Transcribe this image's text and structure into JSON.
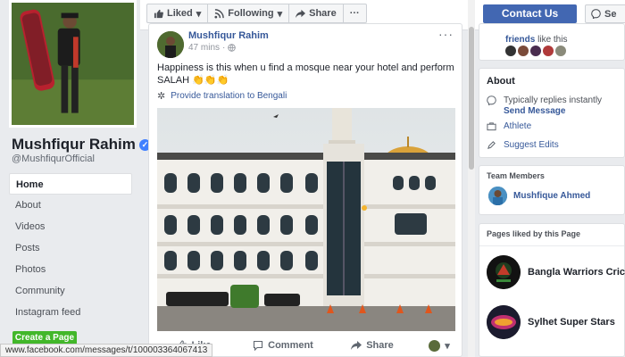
{
  "page": {
    "name": "Mushfiqur Rahim",
    "handle": "@MushfiqurOfficial"
  },
  "leftnav": {
    "items": [
      {
        "label": "Home"
      },
      {
        "label": "About"
      },
      {
        "label": "Videos"
      },
      {
        "label": "Posts"
      },
      {
        "label": "Photos"
      },
      {
        "label": "Community"
      },
      {
        "label": "Instagram feed"
      }
    ],
    "create_page": "Create a Page"
  },
  "topbar": {
    "liked": "Liked",
    "following": "Following",
    "share": "Share",
    "more": "···",
    "contact": "Contact Us",
    "send": "Se"
  },
  "post": {
    "author": "Mushfiqur Rahim",
    "time": "47 mins",
    "text": "Happiness is this when u find a mosque near your hotel and perform SALAH 👏👏👏",
    "translate": "Provide translation to Bengali",
    "actions": {
      "like": "Like",
      "comment": "Comment",
      "share": "Share"
    }
  },
  "right": {
    "friends_link": "friends",
    "friends_suffix": " like this",
    "about_title": "About",
    "replies": "Typically replies instantly",
    "send_message": "Send Message",
    "category": "Athlete",
    "suggest_edits": "Suggest Edits",
    "team_title": "Team Members",
    "team_member": "Mushfique Ahmed",
    "liked_title": "Pages liked by this Page",
    "liked_pages": [
      {
        "name": "Bangla Warriors Crick..."
      },
      {
        "name": "Sylhet Super Stars"
      }
    ]
  },
  "status_url": "www.facebook.com/messages/t/100003364067413",
  "colors": {
    "brand": "#4267b2",
    "link": "#365899",
    "create_page": "#42b72a"
  }
}
